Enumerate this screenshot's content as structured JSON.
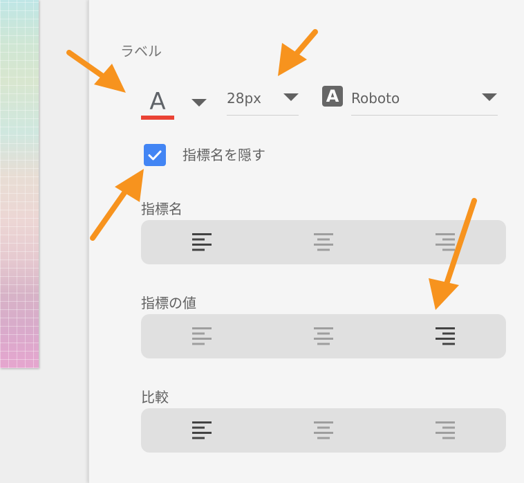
{
  "label_section": {
    "title": "ラベル"
  },
  "font_color": {
    "glyph": "A",
    "color": "#ea4335"
  },
  "font_size": {
    "value": "28px"
  },
  "font_family": {
    "icon_glyph": "A",
    "value": "Roboto"
  },
  "hide_metric_name": {
    "label": "指標名を隠す",
    "checked": true
  },
  "alignment_groups": [
    {
      "label": "指標名",
      "selected": "left"
    },
    {
      "label": "指標の値",
      "selected": "right"
    },
    {
      "label": "比較",
      "selected": "left"
    }
  ],
  "accent_color": "#ff9800"
}
